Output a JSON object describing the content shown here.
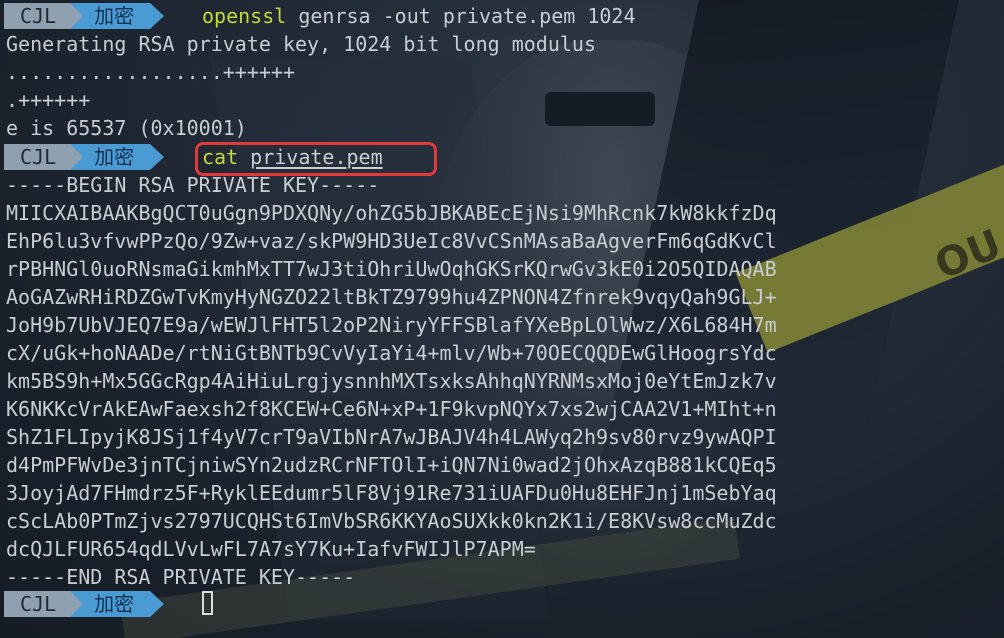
{
  "prompt": {
    "user": "CJL",
    "dir": "加密"
  },
  "commands": [
    {
      "prog": "openssl",
      "args": "genrsa -out private.pem 1024"
    },
    {
      "prog": "cat",
      "args": "private.pem"
    }
  ],
  "gen_output": [
    "Generating RSA private key, 1024 bit long modulus",
    "..................++++++",
    ".++++++",
    "e is 65537 (0x10001)"
  ],
  "key_output": [
    "-----BEGIN RSA PRIVATE KEY-----",
    "MIICXAIBAAKBgQCT0uGgn9PDXQNy/ohZG5bJBKABEcEjNsi9MhRcnk7kW8kkfzDq",
    "EhP6lu3vfvwPPzQo/9Zw+vaz/skPW9HD3UeIc8VvCSnMAsaBaAgverFm6qGdKvCl",
    "rPBHNGl0uoRNsmaGikmhMxTT7wJ3tiOhriUwOqhGKSrKQrwGv3kE0i2O5QIDAQAB",
    "AoGAZwRHiRDZGwTvKmyHyNGZO22ltBkTZ9799hu4ZPNON4Zfnrek9vqyQah9GLJ+",
    "JoH9b7UbVJEQ7E9a/wEWJlFHT5l2oP2NiryYFFSBlafYXeBpLOlWwz/X6L684H7m",
    "cX/uGk+hoNAADe/rtNiGtBNTb9CvVyIaYi4+mlv/Wb+70OECQQDEwGlHoogrsYdc",
    "km5BS9h+Mx5GGcRgp4AiHiuLrgjysnnhMXTsxksAhhqNYRNMsxMoj0eYtEmJzk7v",
    "K6NKKcVrAkEAwFaexsh2f8KCEW+Ce6N+xP+1F9kvpNQYx7xs2wjCAA2V1+MIht+n",
    "ShZ1FLIpyjK8JSj1f4yV7crT9aVIbNrA7wJBAJV4h4LAWyq2h9sv80rvz9ywAQPI",
    "d4PmPFWvDe3jnTCjniwSYn2udzRCrNFTOlI+iQN7Ni0wad2jOhxAzqB881kCQEq5",
    "3JoyjAd7FHmdrz5F+RyklEEdumr5lF8Vj91Re731iUAFDu0Hu8EHFJnj1mSebYaq",
    "cScLAb0PTmZjvs2797UCQHSt6ImVbSR6KKYAoSUXkk0kn2K1i/E8KVsw8ccMuZdc",
    "dcQJLFUR654qdLVvLwFL7A7sY7Ku+IafvFWIJlP7APM=",
    "-----END RSA PRIVATE KEY-----"
  ],
  "background": {
    "tape_text": "OU"
  },
  "colors": {
    "command": "#c7d83a",
    "highlight": "#e03a3a",
    "dir_segment": "#4a9ad4",
    "user_segment": "#8fa0b0"
  }
}
